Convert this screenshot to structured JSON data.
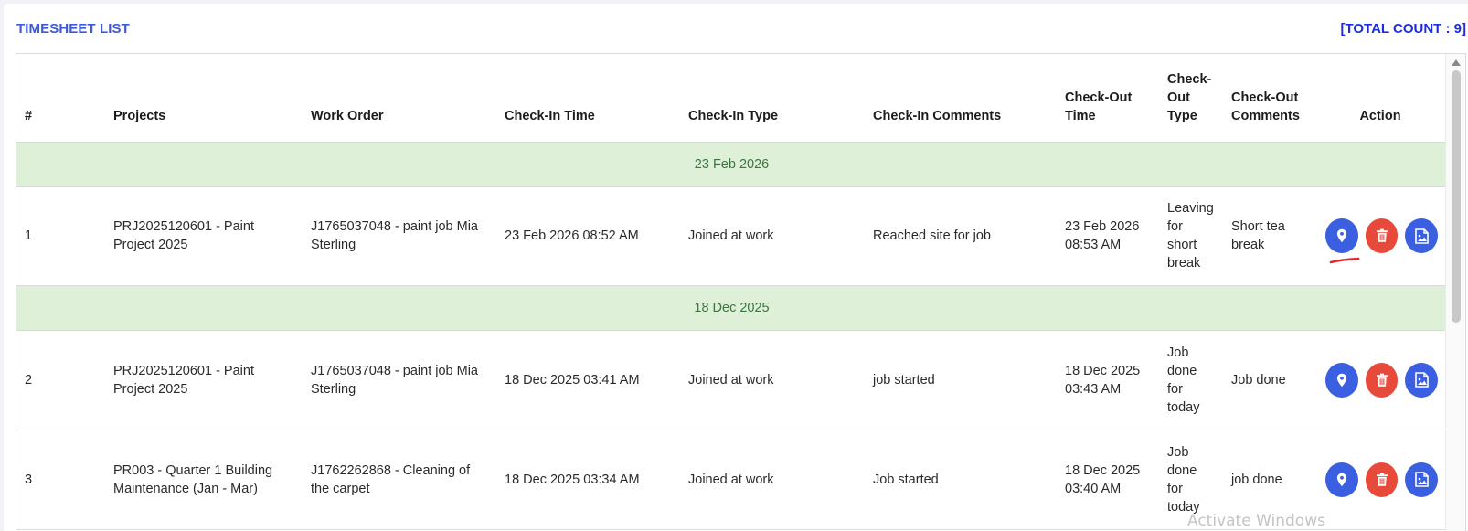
{
  "header": {
    "title": "TIMESHEET LIST",
    "total_count": "[TOTAL COUNT : 9]"
  },
  "table": {
    "columns": [
      "#",
      "Projects",
      "Work Order",
      "Check-In Time",
      "Check-In Type",
      "Check-In Comments",
      "Check-Out Time",
      "Check-Out Type",
      "Check-Out Comments",
      "Action"
    ],
    "groups": [
      {
        "date": "23 Feb 2026",
        "rows": [
          {
            "num": "1",
            "project": "PRJ2025120601 - Paint Project 2025",
            "work_order": "J1765037048 - paint job Mia Sterling",
            "checkin_time": "23 Feb 2026 08:52 AM",
            "checkin_type": "Joined at work",
            "checkin_comments": "Reached site for job",
            "checkout_time": "23 Feb 2026 08:53 AM",
            "checkout_type": "Leaving for short break",
            "checkout_comments": "Short tea break"
          }
        ]
      },
      {
        "date": "18 Dec 2025",
        "rows": [
          {
            "num": "2",
            "project": "PRJ2025120601 - Paint Project 2025",
            "work_order": "J1765037048 - paint job Mia Sterling",
            "checkin_time": "18 Dec 2025 03:41 AM",
            "checkin_type": "Joined at work",
            "checkin_comments": "job started",
            "checkout_time": "18 Dec 2025 03:43 AM",
            "checkout_type": "Job done for today",
            "checkout_comments": "Job done"
          },
          {
            "num": "3",
            "project": "PR003 - Quarter 1 Building Maintenance (Jan - Mar)",
            "work_order": "J1762262868 - Cleaning of the carpet",
            "checkin_time": "18 Dec 2025 03:34 AM",
            "checkin_type": "Joined at work",
            "checkin_comments": "Job started",
            "checkout_time": "18 Dec 2025 03:40 AM",
            "checkout_type": "Job done for today",
            "checkout_comments": "job done"
          }
        ]
      }
    ]
  },
  "actions": {
    "location_icon": "map-pin-icon",
    "delete_icon": "trash-icon",
    "image_icon": "image-file-icon"
  },
  "colors": {
    "title": "#3d5bd9",
    "count": "#1b2fe0",
    "date_row_bg": "#dff0d8",
    "date_row_text": "#3c763d",
    "btn_blue": "#3a5fe0",
    "btn_red": "#e74a3b"
  },
  "watermark": "Activate Windows"
}
